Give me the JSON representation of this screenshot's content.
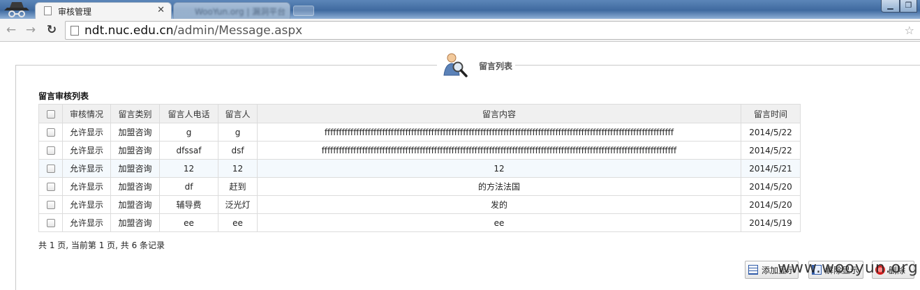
{
  "browser": {
    "active_tab_title": "审核管理",
    "inactive_tab_title": "WooYun.org | 漏洞平台",
    "url_host": "ndt.nuc.edu.cn",
    "url_path": "/admin/Message.aspx",
    "win_minimize": "▁",
    "win_maximize": "❐",
    "tab_close": "✕"
  },
  "page": {
    "legend_title": "留言列表",
    "section_title": "留言审核列表",
    "columns": [
      "审核情况",
      "留言类别",
      "留言人电话",
      "留言人",
      "留言内容",
      "留言时间"
    ],
    "rows": [
      {
        "status": "允许显示",
        "category": "加盟咨询",
        "phone": "g",
        "name": "g",
        "content": "fffffffffffffffffffffffffffffffffffffffffffffffffffffffffffffffffffffffffffffffffffffffffffffffffffffffffffffffffffffffff",
        "time": "2014/5/22"
      },
      {
        "status": "允许显示",
        "category": "加盟咨询",
        "phone": "dfssaf",
        "name": "dsf",
        "content": "fffffffffffffffffffffffffffffffffffffffffffffffffffffffffffffffffffffffffffffffffffffffffffffffffffffffffffffffffffffffffff",
        "time": "2014/5/22"
      },
      {
        "status": "允许显示",
        "category": "加盟咨询",
        "phone": "12",
        "name": "12",
        "content": "12",
        "time": "2014/5/21"
      },
      {
        "status": "允许显示",
        "category": "加盟咨询",
        "phone": "df",
        "name": "赶到",
        "content": "的方法法国",
        "time": "2014/5/20"
      },
      {
        "status": "允许显示",
        "category": "加盟咨询",
        "phone": "辅导费",
        "name": "泛光灯",
        "content": "发的",
        "time": "2014/5/20"
      },
      {
        "status": "允许显示",
        "category": "加盟咨询",
        "phone": "ee",
        "name": "ee",
        "content": "ee",
        "time": "2014/5/19"
      }
    ],
    "pager_text": "共 1 页, 当前第 1 页, 共 6 条记录",
    "buttons": {
      "add": "添加显示",
      "unlock": "解除显示",
      "delete": "删除"
    },
    "watermark": "www.wooyun.org"
  },
  "colors": {
    "highlight_row": "#f4f9fd",
    "header_bg": "#f0f0f0"
  }
}
